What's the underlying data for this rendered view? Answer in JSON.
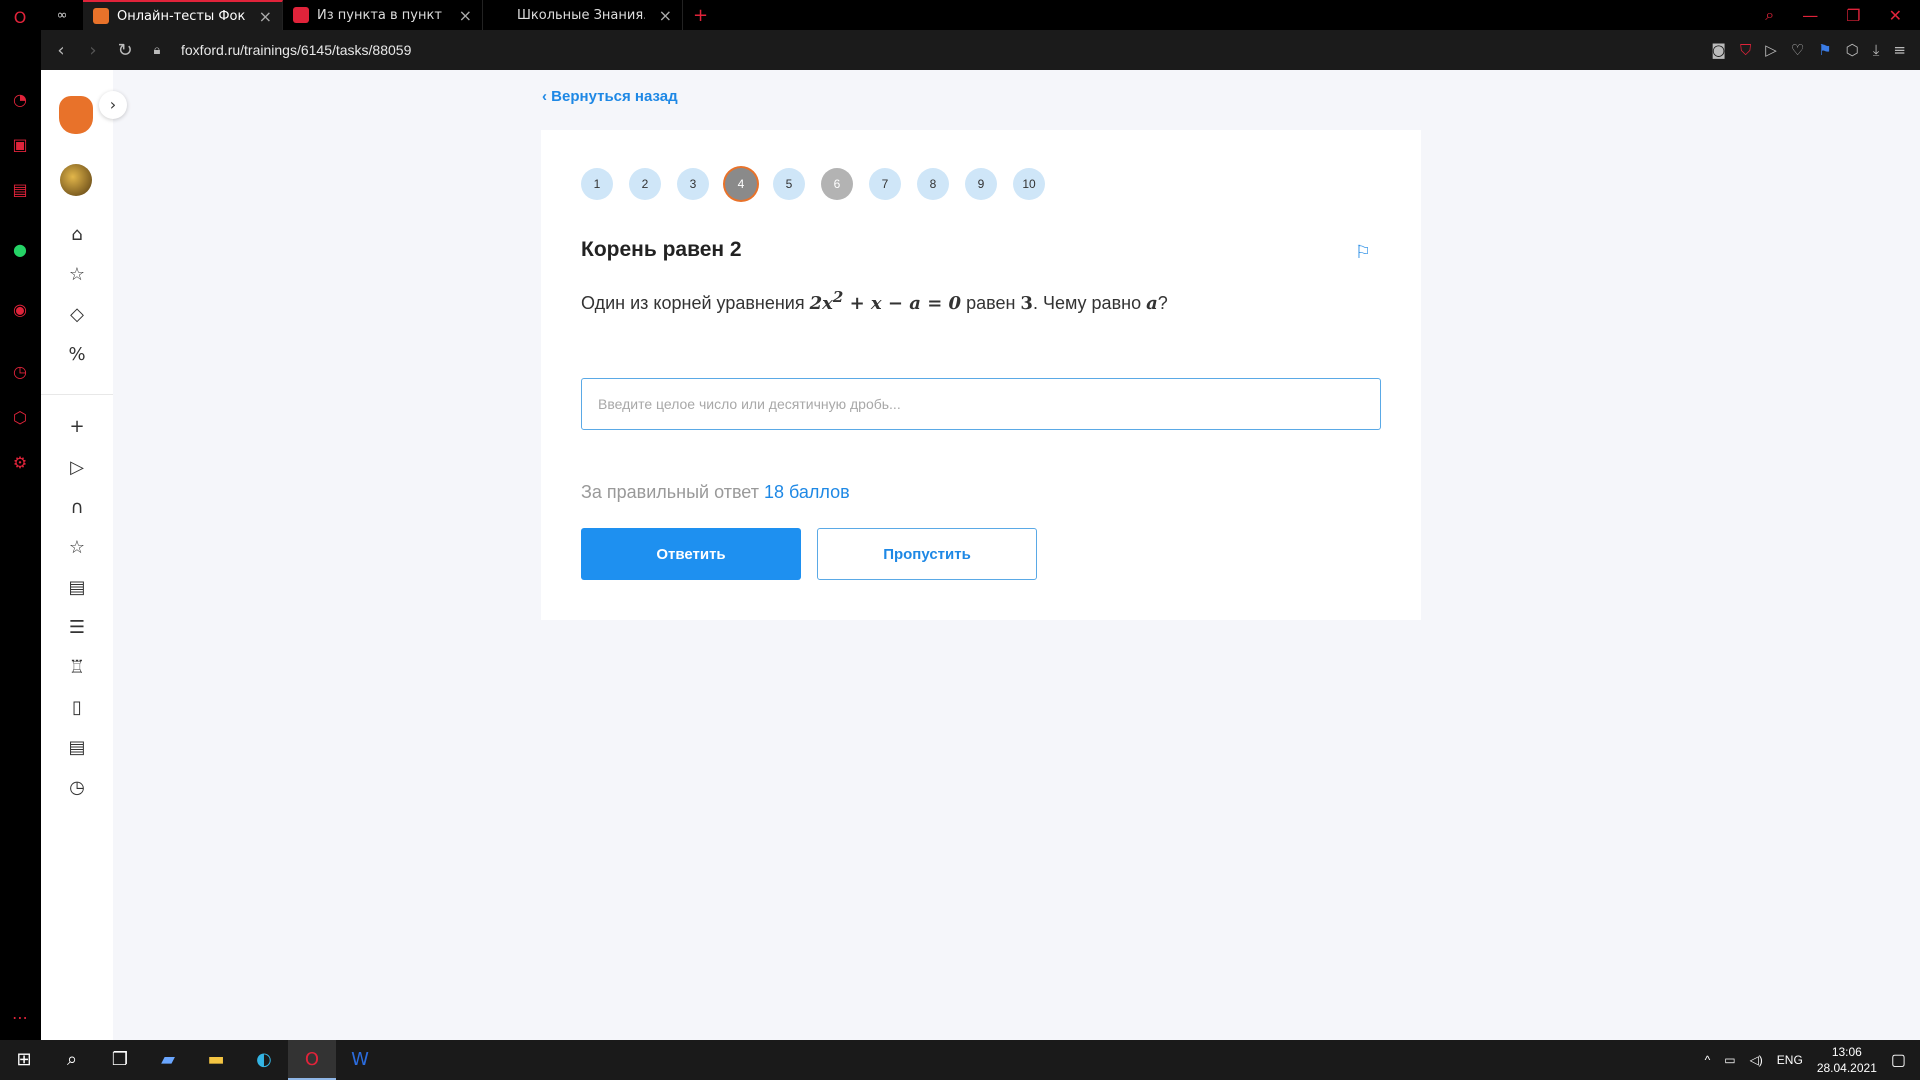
{
  "browser": {
    "tabs": [
      {
        "title": "Онлайн-тесты Фоксфорд",
        "favicon_color": "#e8722a",
        "active": true
      },
      {
        "title": "Из пункта в пункт , рассто",
        "favicon_color": "#e0233a",
        "active": false
      },
      {
        "title": "Школьные Знания.com - F",
        "favicon_color": "#000000",
        "active": false
      }
    ],
    "new_tab": "+",
    "url": "foxford.ru/trainings/6145/tasks/88059"
  },
  "page": {
    "back_link": "Вернуться назад",
    "pager": [
      "1",
      "2",
      "3",
      "4",
      "5",
      "6",
      "7",
      "8",
      "9",
      "10"
    ],
    "current_page": "4",
    "skipped_page": "6",
    "task_title": "Корень равен 2",
    "question": {
      "prefix": "Один из корней уравнения ",
      "equation_html": "2x<sup>2</sup> + x − a = 0",
      "middle": " равен ",
      "root": "3",
      "suffix": ". Чему равно ",
      "var": "a",
      "end": "?"
    },
    "answer_placeholder": "Введите целое число или десятичную дробь...",
    "score_prefix": "За правильный ответ ",
    "score_points": "18 баллов",
    "submit_label": "Ответить",
    "skip_label": "Пропустить"
  },
  "taskbar": {
    "lang": "ENG",
    "time": "13:06",
    "date": "28.04.2021"
  },
  "colors": {
    "accent": "#1e88e5",
    "opera_red": "#e0233a",
    "fox_orange": "#e8722a"
  }
}
